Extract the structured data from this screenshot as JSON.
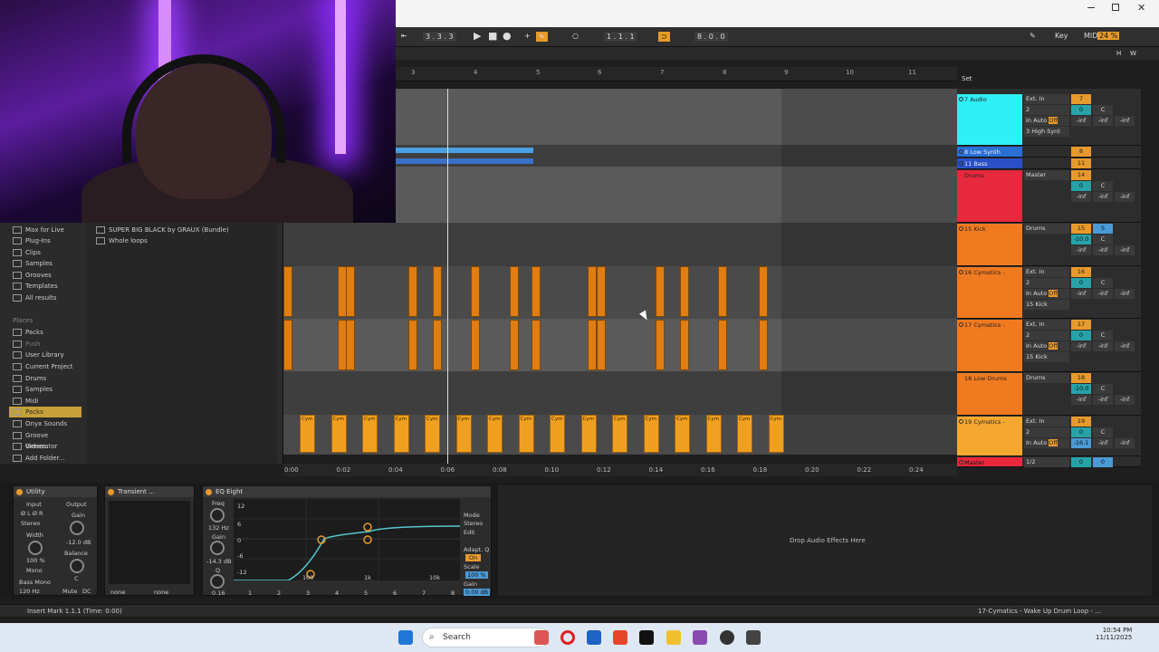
{
  "transport": {
    "position": "3 . 3 . 3",
    "loop_start": "1 . 1 . 1",
    "loop_len": "8 . 0 . 0",
    "key_label": "Key",
    "midi_label": "MIDI",
    "cpu": "24 %",
    "h_label": "H",
    "w_label": "W"
  },
  "ruler": {
    "bars": [
      "3",
      "4",
      "5",
      "6",
      "7",
      "8",
      "9",
      "10",
      "11"
    ],
    "set_label": "Set"
  },
  "time_ruler": [
    "0:00",
    "0:02",
    "0:04",
    "0:06",
    "0:08",
    "0:10",
    "0:12",
    "0:14",
    "0:16",
    "0:18",
    "0:20",
    "0:22",
    "0:24"
  ],
  "browser": {
    "collections": [
      "Max for Live",
      "Plug-Ins",
      "Clips",
      "Samples",
      "Grooves",
      "Templates",
      "All results"
    ],
    "places_header": "Places",
    "places": [
      "Packs",
      "Push",
      "User Library",
      "Current Project",
      "Drums",
      "Samples",
      "Midi",
      "Packs",
      "Onyx Sounds",
      "Groove Generator",
      "Videos",
      "Add Folder..."
    ],
    "selected_place": "Packs",
    "content": [
      "SUPER BIG BLACK by GRAUX (Bundle)",
      "Whole loops"
    ]
  },
  "mixer": {
    "tracks": [
      {
        "name": "7 Audio",
        "color": "#2ef0f5",
        "input": "Ext. In",
        "channel": "2",
        "mon": [
          "In",
          "Auto",
          "Off"
        ],
        "route": "3 High Synt",
        "num": "7",
        "vol": "0",
        "pan": "C",
        "meters": [
          "-inf",
          "-inf",
          "-inf"
        ]
      },
      {
        "name": "8 Low Synth",
        "color": "#2a6fd6",
        "num": "8"
      },
      {
        "name": "11 Bass",
        "color": "#2a4fc6",
        "num": "11"
      },
      {
        "name": "Drums",
        "color": "#e8283c",
        "input": "Master",
        "num": "14",
        "vol": "0",
        "pan": "C",
        "meters": [
          "-inf",
          "-inf",
          "-inf"
        ]
      },
      {
        "name": "15 Kick",
        "color": "#f07a20",
        "input": "Drums",
        "num": "15",
        "vol": "-10.0",
        "pan": "C",
        "meters": [
          "-inf",
          "-inf",
          "-inf"
        ]
      },
      {
        "name": "16 Cymatics -",
        "color": "#f07a20",
        "input": "Ext. In",
        "channel": "2",
        "mon": [
          "In",
          "Auto",
          "Off"
        ],
        "route": "15 Kick",
        "num": "16",
        "vol": "0",
        "pan": "C",
        "meters": [
          "-inf",
          "-inf",
          "-inf"
        ]
      },
      {
        "name": "17 Cymatics -",
        "color": "#f07a20",
        "input": "Ext. In",
        "channel": "2",
        "mon": [
          "In",
          "Auto",
          "Off"
        ],
        "route": "15 Kick",
        "num": "17",
        "vol": "0",
        "pan": "C",
        "meters": [
          "-inf",
          "-inf",
          "-inf"
        ]
      },
      {
        "name": "18 Low Drums",
        "color": "#f07a20",
        "input": "Drums",
        "num": "18",
        "vol": "-10.0",
        "pan": "C",
        "meters": [
          "-inf",
          "-inf",
          "-inf"
        ]
      },
      {
        "name": "19 Cymatics -",
        "color": "#f5a830",
        "input": "Ext. In",
        "channel": "2",
        "mon": [
          "In",
          "Auto",
          "Off"
        ],
        "route": "18 Low Drum",
        "num": "19",
        "vol": "0",
        "pan": "C",
        "meters": [
          "-16.1",
          "-inf",
          "-inf"
        ]
      },
      {
        "name": "Master",
        "color": "#e8283c",
        "input": "1/2",
        "vol": "0",
        "pan": "0"
      }
    ]
  },
  "devices": {
    "utility": {
      "title": "Utility",
      "input": "Input",
      "output": "Output",
      "phase": "Ø L  Ø R",
      "stereo": "Stereo",
      "gain_label": "Gain",
      "gain": "-12.0 dB",
      "width_label": "Width",
      "width": "100 %",
      "balance_label": "Balance",
      "balance": "C",
      "mono": "Mono",
      "bass_mono": "Bass Mono",
      "bass_freq": "120 Hz",
      "mute": "Mute",
      "dc": "DC"
    },
    "transient": {
      "title": "Transient ...",
      "sel1": "none",
      "sel2": "none"
    },
    "eq": {
      "title": "EQ Eight",
      "freq_label": "Freq",
      "freq": "132 Hz",
      "gain_label": "Gain",
      "gain": "-14.3 dB",
      "q_label": "Q",
      "q": "0.16",
      "mode_label": "Mode",
      "mode": "Stereo",
      "edit": "Edit",
      "adapt": "Adapt. Q",
      "adapt_val": "On",
      "scale_label": "Scale",
      "scale": "100 %",
      "out_gain_label": "Gain",
      "out_gain": "0.00 dB",
      "bands": [
        "1",
        "2",
        "3",
        "4",
        "5",
        "6",
        "7",
        "8"
      ],
      "db_marks": [
        "12",
        "6",
        "0",
        "-6",
        "-12"
      ],
      "freq_marks": [
        "100",
        "1k",
        "10k"
      ]
    },
    "drop_text": "Drop Audio Effects Here"
  },
  "status": {
    "left": "Insert Mark 1.1.1 (Time: 0:00)",
    "right": "17-Cymatics - Wake Up Drum Loop - ..."
  },
  "taskbar": {
    "search": "Search",
    "time": "10:54 PM",
    "date": "11/11/2025"
  },
  "clips": {
    "label": "Cym"
  },
  "colors": {
    "accent": "#e79a2b",
    "clip_orange": "#f0a020",
    "track_cyan": "#2ef0f5",
    "track_red": "#e8283c",
    "track_blue": "#2a6fd6"
  }
}
